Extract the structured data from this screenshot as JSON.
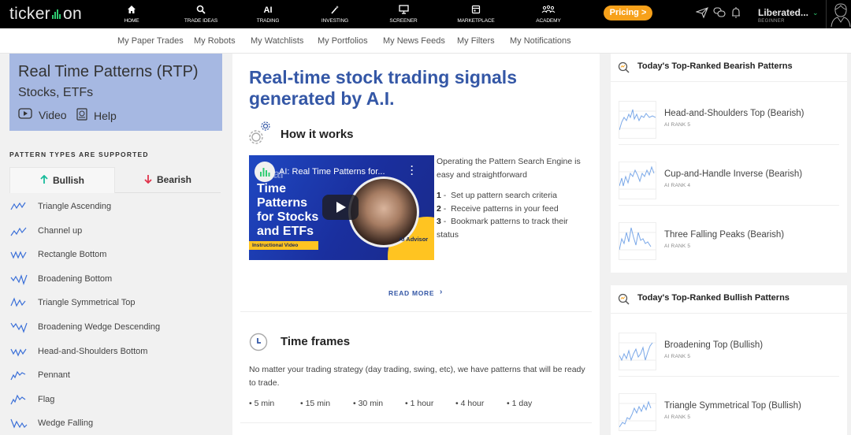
{
  "topbar": {
    "logo_left": "ticker",
    "logo_right": "on",
    "nav": [
      {
        "label": "HOME",
        "icon": "home-icon"
      },
      {
        "label": "TRADE IDEAS",
        "icon": "magnifier-icon"
      },
      {
        "label": "TRADING",
        "icon_text": "AI"
      },
      {
        "label": "INVESTING",
        "icon": "magic-wand-icon"
      },
      {
        "label": "SCREENER",
        "icon": "monitor-icon"
      },
      {
        "label": "MARKETPLACE",
        "icon": "store-icon"
      },
      {
        "label": "ACADEMY",
        "icon": "people-icon"
      }
    ],
    "pricing_label": "Pricing >",
    "user_name": "Liberated...",
    "user_level": "BEGINNER"
  },
  "subnav": [
    "My Paper Trades",
    "My Robots",
    "My Watchlists",
    "My Portfolios",
    "My News Feeds",
    "My Filters",
    "My Notifications"
  ],
  "sidebar": {
    "title": "Real Time Patterns (RTP)",
    "subtitle": "Stocks, ETFs",
    "video_label": "Video",
    "help_label": "Help",
    "pattern_types_heading": "PATTERN TYPES ARE SUPPORTED",
    "tab_bullish": "Bullish",
    "tab_bearish": "Bearish",
    "patterns": [
      "Triangle Ascending",
      "Channel up",
      "Rectangle Bottom",
      "Broadening Bottom",
      "Triangle Symmetrical Top",
      "Broadening Wedge Descending",
      "Head-and-Shoulders Bottom",
      "Pennant",
      "Flag",
      "Wedge Falling"
    ]
  },
  "main": {
    "hero": "Real-time stock trading signals generated by A.I.",
    "how_title": "How it works",
    "video": {
      "header": "AI: Real Time Patterns for...",
      "title_lines": [
        "Real",
        "Time",
        "Patterns",
        "for Stocks",
        "and ETFs"
      ],
      "badge": "Instructional Video",
      "advisor": "AI Advisor"
    },
    "how_intro": "Operating the Pattern Search Engine is easy and straightforward",
    "steps": [
      {
        "num": "1",
        "text": "Set up pattern search criteria"
      },
      {
        "num": "2",
        "text": "Receive patterns in your feed"
      },
      {
        "num": "3",
        "text": "Bookmark patterns to track their status"
      }
    ],
    "read_more": "READ MORE",
    "timeframes_title": "Time frames",
    "timeframes_text": "No matter your trading strategy (day trading, swing, etc), we have patterns that will be ready to trade.",
    "timeframes": [
      "• 5 min",
      "• 15 min",
      "• 30 min",
      "• 1 hour",
      "• 4 hour",
      "• 1 day"
    ]
  },
  "bearish_panel": {
    "title": "Today's Top-Ranked Bearish Patterns",
    "items": [
      {
        "name": "Head-and-Shoulders Top (Bearish)",
        "rank": "AI RANK 5"
      },
      {
        "name": "Cup-and-Handle Inverse (Bearish)",
        "rank": "AI RANK 4"
      },
      {
        "name": "Three Falling Peaks (Bearish)",
        "rank": "AI RANK 5"
      }
    ]
  },
  "bullish_panel": {
    "title": "Today's Top-Ranked Bullish Patterns",
    "items": [
      {
        "name": "Broadening Top (Bullish)",
        "rank": "AI RANK 5"
      },
      {
        "name": "Triangle Symmetrical Top (Bullish)",
        "rank": "AI RANK 5"
      }
    ]
  },
  "colors": {
    "brand_green": "#2ecc71",
    "pricing_orange": "#f7a11a",
    "hero_blue": "#3457a6",
    "rtp_box": "#a6b8e2",
    "bullish_arrow": "#1abc9c",
    "bearish_arrow": "#e0344c",
    "pattern_icon": "#3a6fd8"
  }
}
